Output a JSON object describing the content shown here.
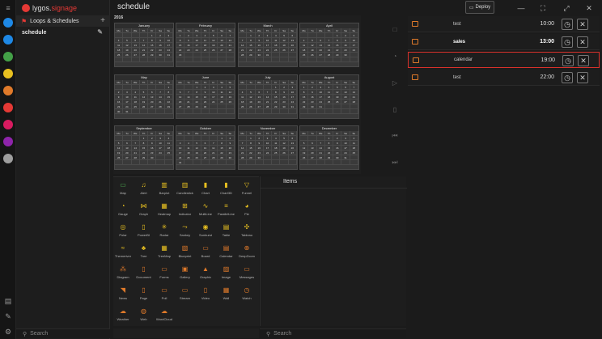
{
  "app": {
    "logo_a": "lygos.",
    "logo_b": "signage",
    "title": "schedule"
  },
  "titlebar": {
    "deploy": "Deploy"
  },
  "sidebar": {
    "section": "Loops & Schedules",
    "item": "schedule",
    "search_placeholder": "Search"
  },
  "calendar": {
    "year": "2016",
    "weekdays": [
      "Mo",
      "Tu",
      "We",
      "Th",
      "Fr",
      "Sa",
      "Su"
    ],
    "months": [
      {
        "name": "January",
        "offset": 4,
        "days": 31
      },
      {
        "name": "February",
        "offset": 0,
        "days": 29
      },
      {
        "name": "March",
        "offset": 1,
        "days": 31
      },
      {
        "name": "April",
        "offset": 4,
        "days": 30
      },
      {
        "name": "May",
        "offset": 6,
        "days": 31
      },
      {
        "name": "June",
        "offset": 2,
        "days": 30
      },
      {
        "name": "July",
        "offset": 4,
        "days": 31
      },
      {
        "name": "August",
        "offset": 0,
        "days": 31
      },
      {
        "name": "September",
        "offset": 3,
        "days": 30
      },
      {
        "name": "October",
        "offset": 5,
        "days": 31
      },
      {
        "name": "November",
        "offset": 1,
        "days": 30
      },
      {
        "name": "December",
        "offset": 3,
        "days": 31
      }
    ]
  },
  "schedule": [
    {
      "name": "test",
      "time": "10:00",
      "bold": false,
      "selected": false
    },
    {
      "name": "sales",
      "time": "13:00",
      "bold": true,
      "selected": false
    },
    {
      "name": "calendar",
      "time": "19:00",
      "bold": false,
      "selected": true
    },
    {
      "name": "test",
      "time": "22:00",
      "bold": false,
      "selected": false
    }
  ],
  "palette": [
    {
      "label": "Map",
      "glyph": "▭",
      "color": "#4caf50"
    },
    {
      "label": "Alert",
      "glyph": "♫",
      "color": "#e8c020"
    },
    {
      "label": "Barplot",
      "glyph": "▥",
      "color": "#e8c020"
    },
    {
      "label": "Candlestick",
      "glyph": "▥",
      "color": "#e8c020"
    },
    {
      "label": "Chart",
      "glyph": "▮",
      "color": "#e8c020"
    },
    {
      "label": "Chart3D",
      "glyph": "▮",
      "color": "#e8c020"
    },
    {
      "label": "Funnel",
      "glyph": "▽",
      "color": "#e8c020"
    },
    {
      "label": "Gauge",
      "glyph": "◔",
      "color": "#e8c020"
    },
    {
      "label": "Graph",
      "glyph": "⋈",
      "color": "#e8c020"
    },
    {
      "label": "Heatmap",
      "glyph": "▦",
      "color": "#e8c020"
    },
    {
      "label": "Indicator",
      "glyph": "⊞",
      "color": "#e8c020"
    },
    {
      "label": "MultiLine",
      "glyph": "∿",
      "color": "#e8c020"
    },
    {
      "label": "ParallelLine",
      "glyph": "≡",
      "color": "#e8c020"
    },
    {
      "label": "Pie",
      "glyph": "◕",
      "color": "#e8c020"
    },
    {
      "label": "Polar",
      "glyph": "◎",
      "color": "#e8c020"
    },
    {
      "label": "PowerBI",
      "glyph": "▯",
      "color": "#e8c020"
    },
    {
      "label": "Radar",
      "glyph": "✳",
      "color": "#e8c020"
    },
    {
      "label": "Sankey",
      "glyph": "⤳",
      "color": "#e8c020"
    },
    {
      "label": "Sunburst",
      "glyph": "◉",
      "color": "#e8c020"
    },
    {
      "label": "Table",
      "glyph": "▤",
      "color": "#e8c020"
    },
    {
      "label": "Tableau",
      "glyph": "✣",
      "color": "#e8c020"
    },
    {
      "label": "Themeriver",
      "glyph": "≈",
      "color": "#e8c020"
    },
    {
      "label": "Tree",
      "glyph": "♣",
      "color": "#e8c020"
    },
    {
      "label": "TreeMap",
      "glyph": "▦",
      "color": "#e8c020"
    },
    {
      "label": "Blueprint",
      "glyph": "▧",
      "color": "#e07a2a"
    },
    {
      "label": "Board",
      "glyph": "▭",
      "color": "#e07a2a"
    },
    {
      "label": "Calendar",
      "glyph": "▤",
      "color": "#e07a2a"
    },
    {
      "label": "DeepZoom",
      "glyph": "⊕",
      "color": "#e07a2a"
    },
    {
      "label": "Diagram",
      "glyph": "⁂",
      "color": "#e07a2a"
    },
    {
      "label": "Document",
      "glyph": "▯",
      "color": "#e07a2a"
    },
    {
      "label": "Forms",
      "glyph": "▭",
      "color": "#e07a2a"
    },
    {
      "label": "Gallery",
      "glyph": "▣",
      "color": "#e07a2a"
    },
    {
      "label": "Graphic",
      "glyph": "▲",
      "color": "#e07a2a"
    },
    {
      "label": "Image",
      "glyph": "▨",
      "color": "#e07a2a"
    },
    {
      "label": "Messages",
      "glyph": "▭",
      "color": "#e07a2a"
    },
    {
      "label": "News",
      "glyph": "◥",
      "color": "#e07a2a"
    },
    {
      "label": "Page",
      "glyph": "▯",
      "color": "#e07a2a"
    },
    {
      "label": "Poll",
      "glyph": "▭",
      "color": "#e07a2a"
    },
    {
      "label": "Stream",
      "glyph": "▭",
      "color": "#e07a2a"
    },
    {
      "label": "Video",
      "glyph": "▯",
      "color": "#e07a2a"
    },
    {
      "label": "Wall",
      "glyph": "▦",
      "color": "#e07a2a"
    },
    {
      "label": "Watch",
      "glyph": "◷",
      "color": "#e07a2a"
    },
    {
      "label": "Weather",
      "glyph": "☁",
      "color": "#e07a2a"
    },
    {
      "label": "Web",
      "glyph": "◍",
      "color": "#e07a2a"
    },
    {
      "label": "WordCloud",
      "glyph": "☁",
      "color": "#e07a2a"
    }
  ],
  "items": {
    "title": "Items",
    "search_placeholder": "Search"
  },
  "rail": [
    {
      "name": "rail-app-1",
      "color": "#1e88e5"
    },
    {
      "name": "rail-app-2",
      "color": "#1e88e5"
    },
    {
      "name": "rail-app-3",
      "color": "#43a047"
    },
    {
      "name": "rail-app-4",
      "color": "#e8c020"
    },
    {
      "name": "rail-app-5",
      "color": "#e07a2a"
    },
    {
      "name": "rail-app-6",
      "color": "#e53935"
    },
    {
      "name": "rail-app-7",
      "color": "#d81b60"
    },
    {
      "name": "rail-app-8",
      "color": "#8e24aa"
    },
    {
      "name": "rail-app-9",
      "color": "#9e9e9e"
    }
  ]
}
